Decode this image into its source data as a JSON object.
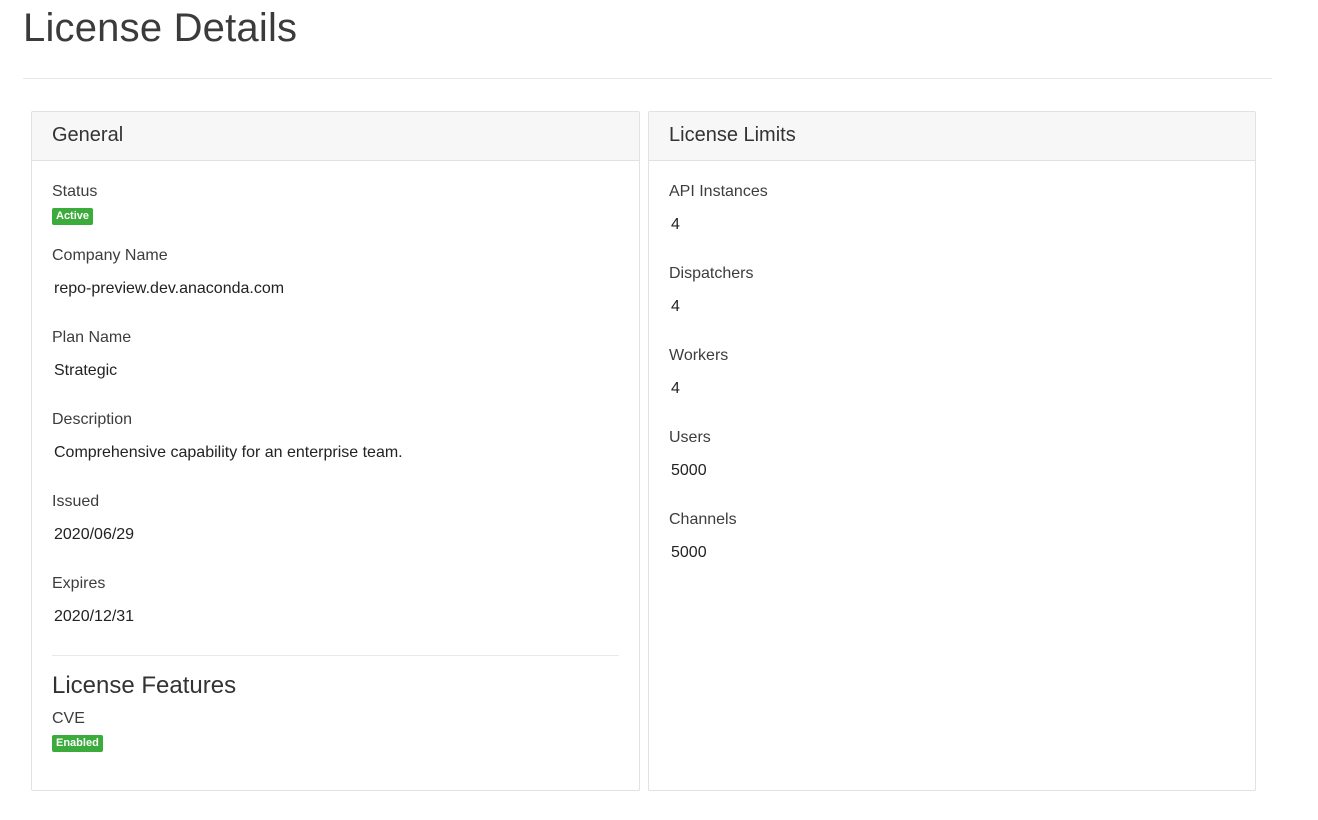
{
  "page": {
    "title": "License Details"
  },
  "general": {
    "header": "General",
    "status": {
      "label": "Status",
      "badge": "Active"
    },
    "company_name": {
      "label": "Company Name",
      "value": "repo-preview.dev.anaconda.com"
    },
    "plan_name": {
      "label": "Plan Name",
      "value": "Strategic"
    },
    "description": {
      "label": "Description",
      "value": "Comprehensive capability for an enterprise team."
    },
    "issued": {
      "label": "Issued",
      "value": "2020/06/29"
    },
    "expires": {
      "label": "Expires",
      "value": "2020/12/31"
    },
    "features": {
      "title": "License Features",
      "items": [
        {
          "label": "CVE",
          "badge": "Enabled"
        }
      ]
    }
  },
  "limits": {
    "header": "License Limits",
    "items": [
      {
        "label": "API Instances",
        "value": "4"
      },
      {
        "label": "Dispatchers",
        "value": "4"
      },
      {
        "label": "Workers",
        "value": "4"
      },
      {
        "label": "Users",
        "value": "5000"
      },
      {
        "label": "Channels",
        "value": "5000"
      }
    ]
  },
  "colors": {
    "badge_green": "#3bab3b",
    "panel_header_bg": "#f7f7f7",
    "border": "#e2e2e2"
  }
}
